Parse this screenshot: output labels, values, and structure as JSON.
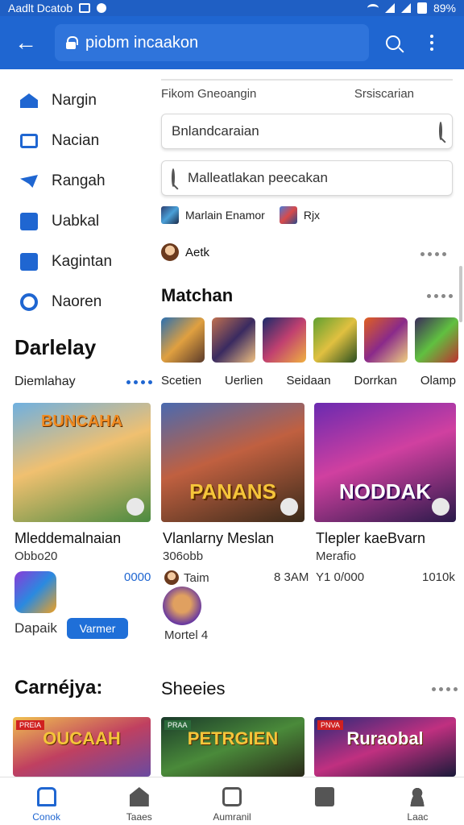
{
  "status_bar": {
    "carrier": "Aadlt Dcatob",
    "battery": "89%"
  },
  "app_bar": {
    "url": "piobm incaakon"
  },
  "sidebar": {
    "items": [
      {
        "label": "Nargin",
        "icon": "home-icon"
      },
      {
        "label": "Nacian",
        "icon": "briefcase-icon"
      },
      {
        "label": "Rangah",
        "icon": "chat-icon"
      },
      {
        "label": "Uabkal",
        "icon": "plane-icon"
      },
      {
        "label": "Kagintan",
        "icon": "image-icon"
      },
      {
        "label": "Naoren",
        "icon": "settings-icon"
      }
    ]
  },
  "filters": {
    "left": "Fikom Gneoangin",
    "right": "Srsiscarian"
  },
  "field1": {
    "value": "Bnlandcaraian"
  },
  "field2": {
    "placeholder": "Malleatlakan peecakan"
  },
  "chips": {
    "first": "Marlain Enamor",
    "second": "Rjx"
  },
  "user": {
    "name": "Aetk"
  },
  "matchan": {
    "title": "Matchan",
    "labels": [
      "Scetien",
      "Uerlien",
      "Seidaan",
      "Dorrkan",
      "Olamp"
    ]
  },
  "darlelay": {
    "title": "Darlelay",
    "subtitle": "Diemlahay"
  },
  "cards": [
    {
      "art": "BUNCAHA",
      "title": "Mleddemalnaian",
      "sub": "Obbo20"
    },
    {
      "art": "PANANS",
      "title": "Vlanlarny Meslan",
      "sub": "306obb"
    },
    {
      "art": "NODDAK",
      "title": "Tlepler kaeBvarn",
      "sub": "Merafio"
    }
  ],
  "meta": {
    "app_label": "Dapaik",
    "install_label": "Varmer",
    "score": "0000",
    "taim": "Taim",
    "time": "8 3AM",
    "price": "Y1 0/000",
    "size": "1010k",
    "round_label": "Mortel 4"
  },
  "sections": {
    "left": "Carnéjya:",
    "right": "Sheeies"
  },
  "bottom_cards": [
    "OUCAAH",
    "PETRGIEN",
    "Ruraobal"
  ],
  "bottom_tags": [
    "PREIA",
    "PRAA",
    "PNVA"
  ],
  "bottom_nav": [
    {
      "label": "Conok",
      "icon": "home-icon",
      "active": true
    },
    {
      "label": "Taaes",
      "icon": "store-icon",
      "active": false
    },
    {
      "label": "Aumranil",
      "icon": "clock-icon",
      "active": false
    },
    {
      "label": "",
      "icon": "book-icon",
      "active": false
    },
    {
      "label": "Laac",
      "icon": "user-icon",
      "active": false
    }
  ],
  "colors": {
    "primary": "#1f66d1",
    "appbar": "#1f66d1",
    "statusbar": "#1f5fc4"
  }
}
